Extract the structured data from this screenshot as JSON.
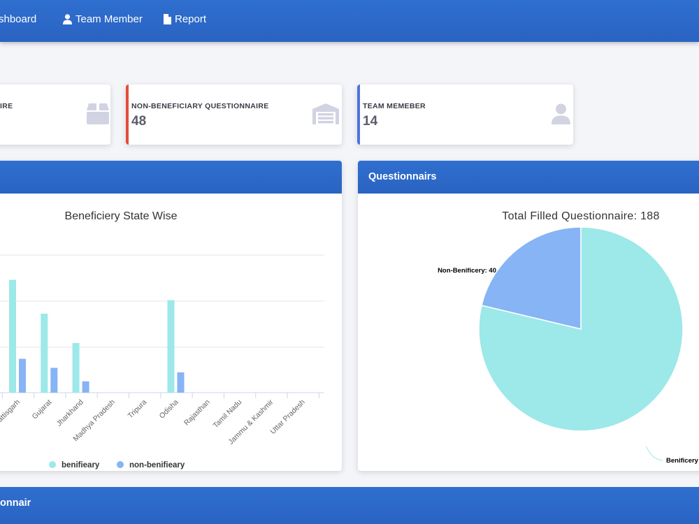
{
  "nav": {
    "items": [
      {
        "label": "shboard"
      },
      {
        "label": "Team Member",
        "icon": "user-icon"
      },
      {
        "label": "Report",
        "icon": "file-icon"
      }
    ]
  },
  "cards": [
    {
      "label": "IRE",
      "value": "",
      "accent": "",
      "icon": "box-icon"
    },
    {
      "label": "NON-BENEFICIARY QUESTIONNAIRE",
      "value": "48",
      "accent": "#e74a3b",
      "icon": "warehouse-icon"
    },
    {
      "label": "TEAM MEMEBER",
      "value": "14",
      "accent": "#4e73df",
      "icon": "user-icon"
    }
  ],
  "panels": {
    "left_title": "",
    "right_title": "Questionnairs",
    "bottom_title": "onnair"
  },
  "colors": {
    "primary": "#2f6fcf",
    "beneficiary": "#9de8e8",
    "non_beneficiary": "#86b4f5"
  },
  "chart_data": [
    {
      "type": "bar",
      "title": "Beneficiery State Wise",
      "categories": [
        "hattisgarh",
        "Gujarat",
        "Jharkhand",
        "Madhya Pradesh",
        "Tripura",
        "Odisha",
        "Rajasthan",
        "Tamil Nadu",
        "Jammu & Kashmir",
        "Uttar Pradesh"
      ],
      "series": [
        {
          "name": "benifieary",
          "values": [
            50,
            35,
            22,
            0,
            0,
            41,
            0,
            0,
            0,
            0
          ]
        },
        {
          "name": "non-benifieary",
          "values": [
            15,
            11,
            5,
            0,
            0,
            9,
            0,
            0,
            0,
            0
          ]
        }
      ],
      "ylim": [
        0,
        61
      ],
      "grid": true,
      "legend": "bottom"
    },
    {
      "type": "pie",
      "title": "Total Filled Questionnaire: 188",
      "labels": [
        "Non-Benificery: 40",
        "Benificery"
      ],
      "values": [
        40,
        148
      ],
      "legend": "none"
    }
  ]
}
